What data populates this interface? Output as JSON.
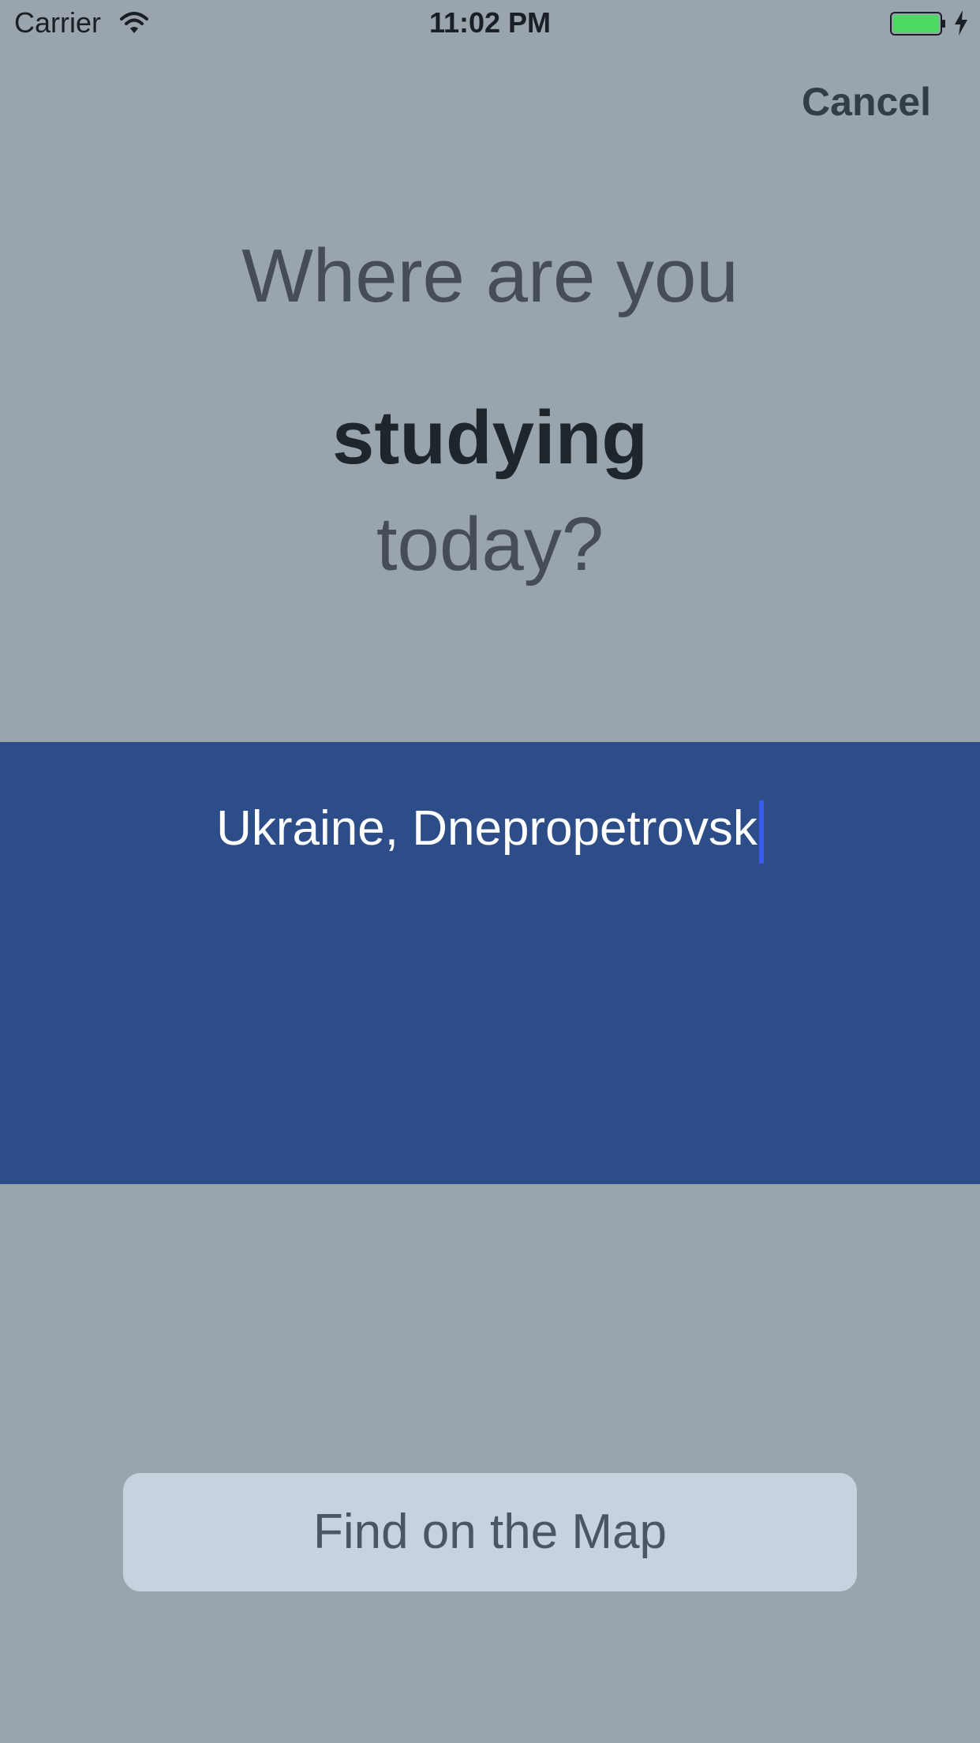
{
  "status_bar": {
    "carrier": "Carrier",
    "time": "11:02 PM",
    "battery_color": "#4cd964",
    "icons": [
      "wifi-icon",
      "battery-icon",
      "charging-icon"
    ]
  },
  "header": {
    "cancel_label": "Cancel"
  },
  "prompt": {
    "line1": "Where are you",
    "line2": "studying",
    "line3": "today?"
  },
  "location": {
    "value": "Ukraine, Dnepropetrovsk",
    "panel_color": "#2c4d88"
  },
  "actions": {
    "find_label": "Find on the Map"
  }
}
